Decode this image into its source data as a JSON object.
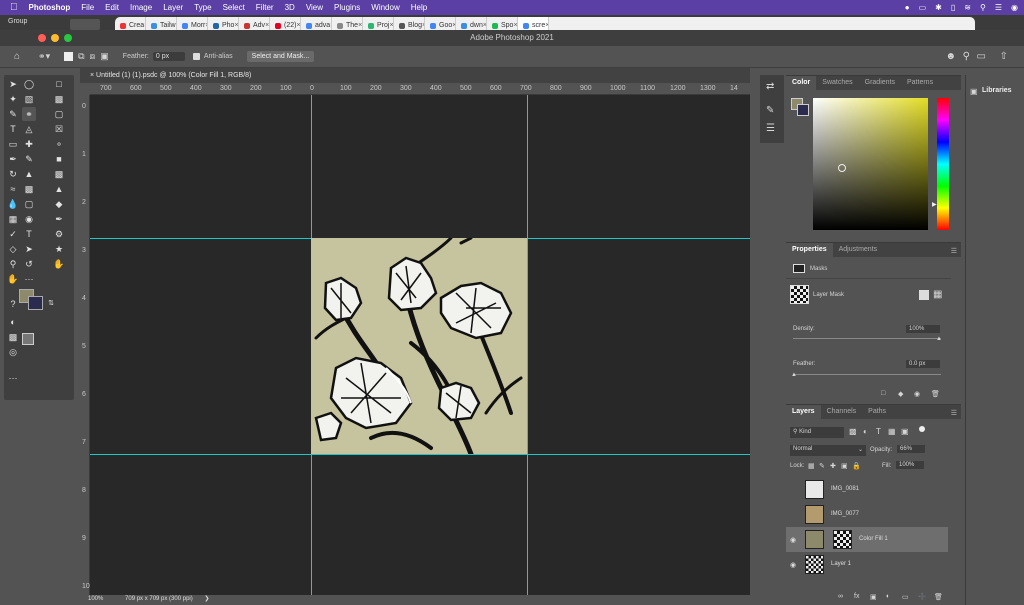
{
  "menubar": {
    "apple_icon": "apple-icon",
    "app_name": "Photoshop",
    "items": [
      "File",
      "Edit",
      "Image",
      "Layer",
      "Type",
      "Select",
      "Filter",
      "3D",
      "View",
      "Plugins",
      "Window",
      "Help"
    ]
  },
  "browser": {
    "tabs": [
      "Crea",
      "Tailw",
      "Morr",
      "Pho",
      "Adv",
      "(22)",
      "adva",
      "The",
      "Proj",
      "Blog",
      "Goo",
      "dwn",
      "Spo",
      "scre"
    ]
  },
  "titlebar": {
    "workspace_label": "Group",
    "title": "Adobe Photoshop 2021"
  },
  "options": {
    "feather_label": "Feather:",
    "feather_value": "0 px",
    "antialias_label": "Anti-alias",
    "select_mask_label": "Select and Mask..."
  },
  "document": {
    "tab_title": "Untitled (1) (1).psdc @ 100% (Color Fill 1, RGB/8)",
    "ruler_h": [
      "700",
      "600",
      "500",
      "400",
      "300",
      "200",
      "100",
      "0",
      "100",
      "200",
      "300",
      "400",
      "500",
      "600",
      "700",
      "800",
      "900",
      "1000",
      "1100",
      "1200",
      "1300",
      "14"
    ],
    "ruler_v": [
      "0",
      "1",
      "2",
      "3",
      "4",
      "5",
      "6",
      "7",
      "8",
      "9",
      "10"
    ],
    "zoom": "100%",
    "doc_info": "709 px x 709 px (300 ppi)"
  },
  "color_panel": {
    "tabs": [
      "Color",
      "Swatches",
      "Gradients",
      "Patterns"
    ]
  },
  "properties": {
    "tabs": [
      "Properties",
      "Adjustments"
    ],
    "masks_label": "Masks",
    "layer_mask_label": "Layer Mask",
    "density_label": "Density:",
    "density_value": "100%",
    "feather_label": "Feather:",
    "feather_value": "0.0 px"
  },
  "layers_panel": {
    "tabs": [
      "Layers",
      "Channels",
      "Paths"
    ],
    "kind_label": "Kind",
    "blend_mode": "Normal",
    "opacity_label": "Opacity:",
    "opacity_value": "66%",
    "lock_label": "Lock:",
    "fill_label": "Fill:",
    "fill_value": "100%",
    "layers": [
      {
        "name": "IMG_0081",
        "visible": false
      },
      {
        "name": "IMG_0077",
        "visible": false
      },
      {
        "name": "Color Fill 1",
        "visible": true,
        "selected": true
      },
      {
        "name": "Layer 1",
        "visible": true
      }
    ]
  },
  "libraries": {
    "label": "Libraries"
  },
  "colors": {
    "accent_menubar": "#5b3fa4",
    "guide": "#21c7c7",
    "fill_color": "#c6c49f",
    "foreground_swatch": "#8c8a6a",
    "background_swatch": "#2b2b4f"
  }
}
